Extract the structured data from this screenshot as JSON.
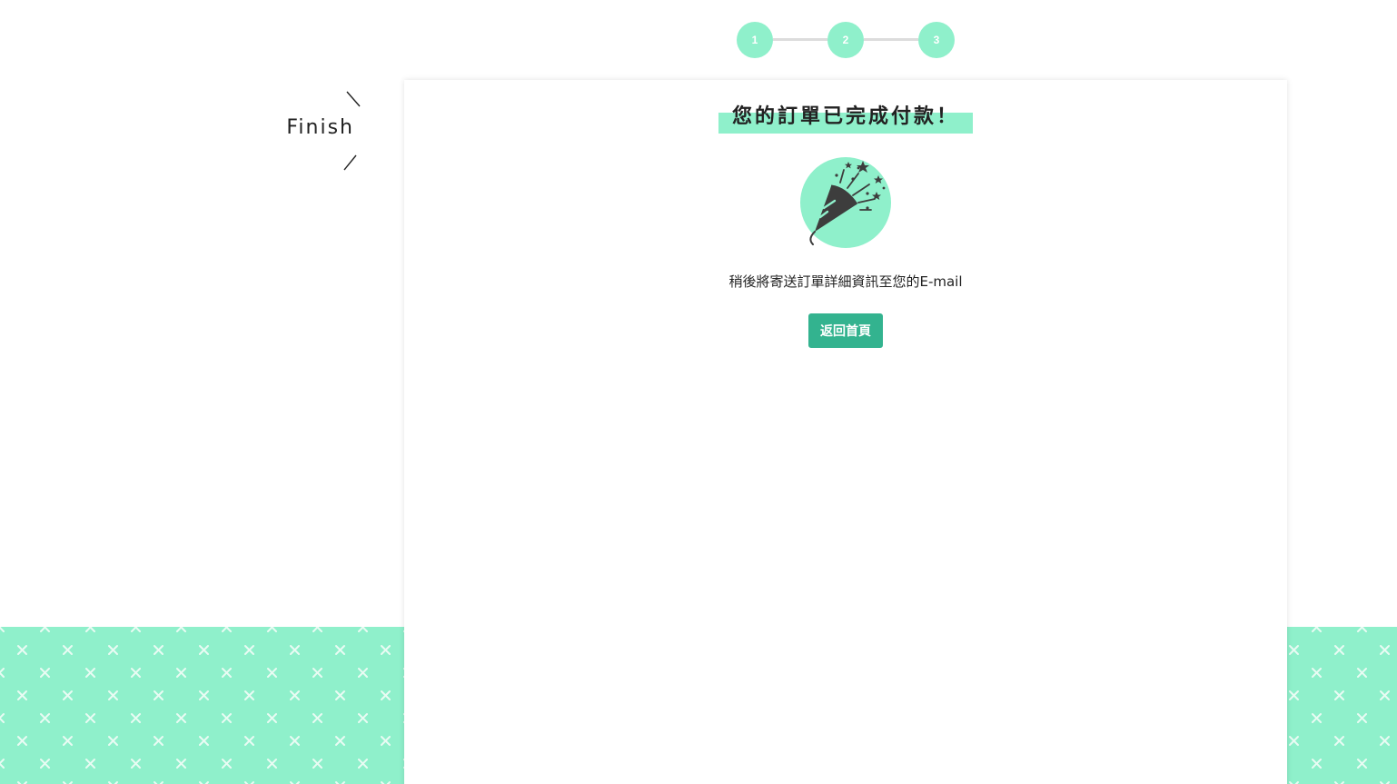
{
  "stepper": {
    "steps": [
      "1",
      "2",
      "3"
    ]
  },
  "side_label": {
    "text": "Finish"
  },
  "card": {
    "title": "您的訂單已完成付款！",
    "message": "稍後將寄送訂單詳細資訊至您的E-mail",
    "home_button_label": "返回首頁",
    "icon": "party-popper-icon"
  },
  "colors": {
    "accent": "#8ff0cb",
    "button": "#33b38f",
    "text": "#222222",
    "icon_dark": "#3d3d3d"
  }
}
